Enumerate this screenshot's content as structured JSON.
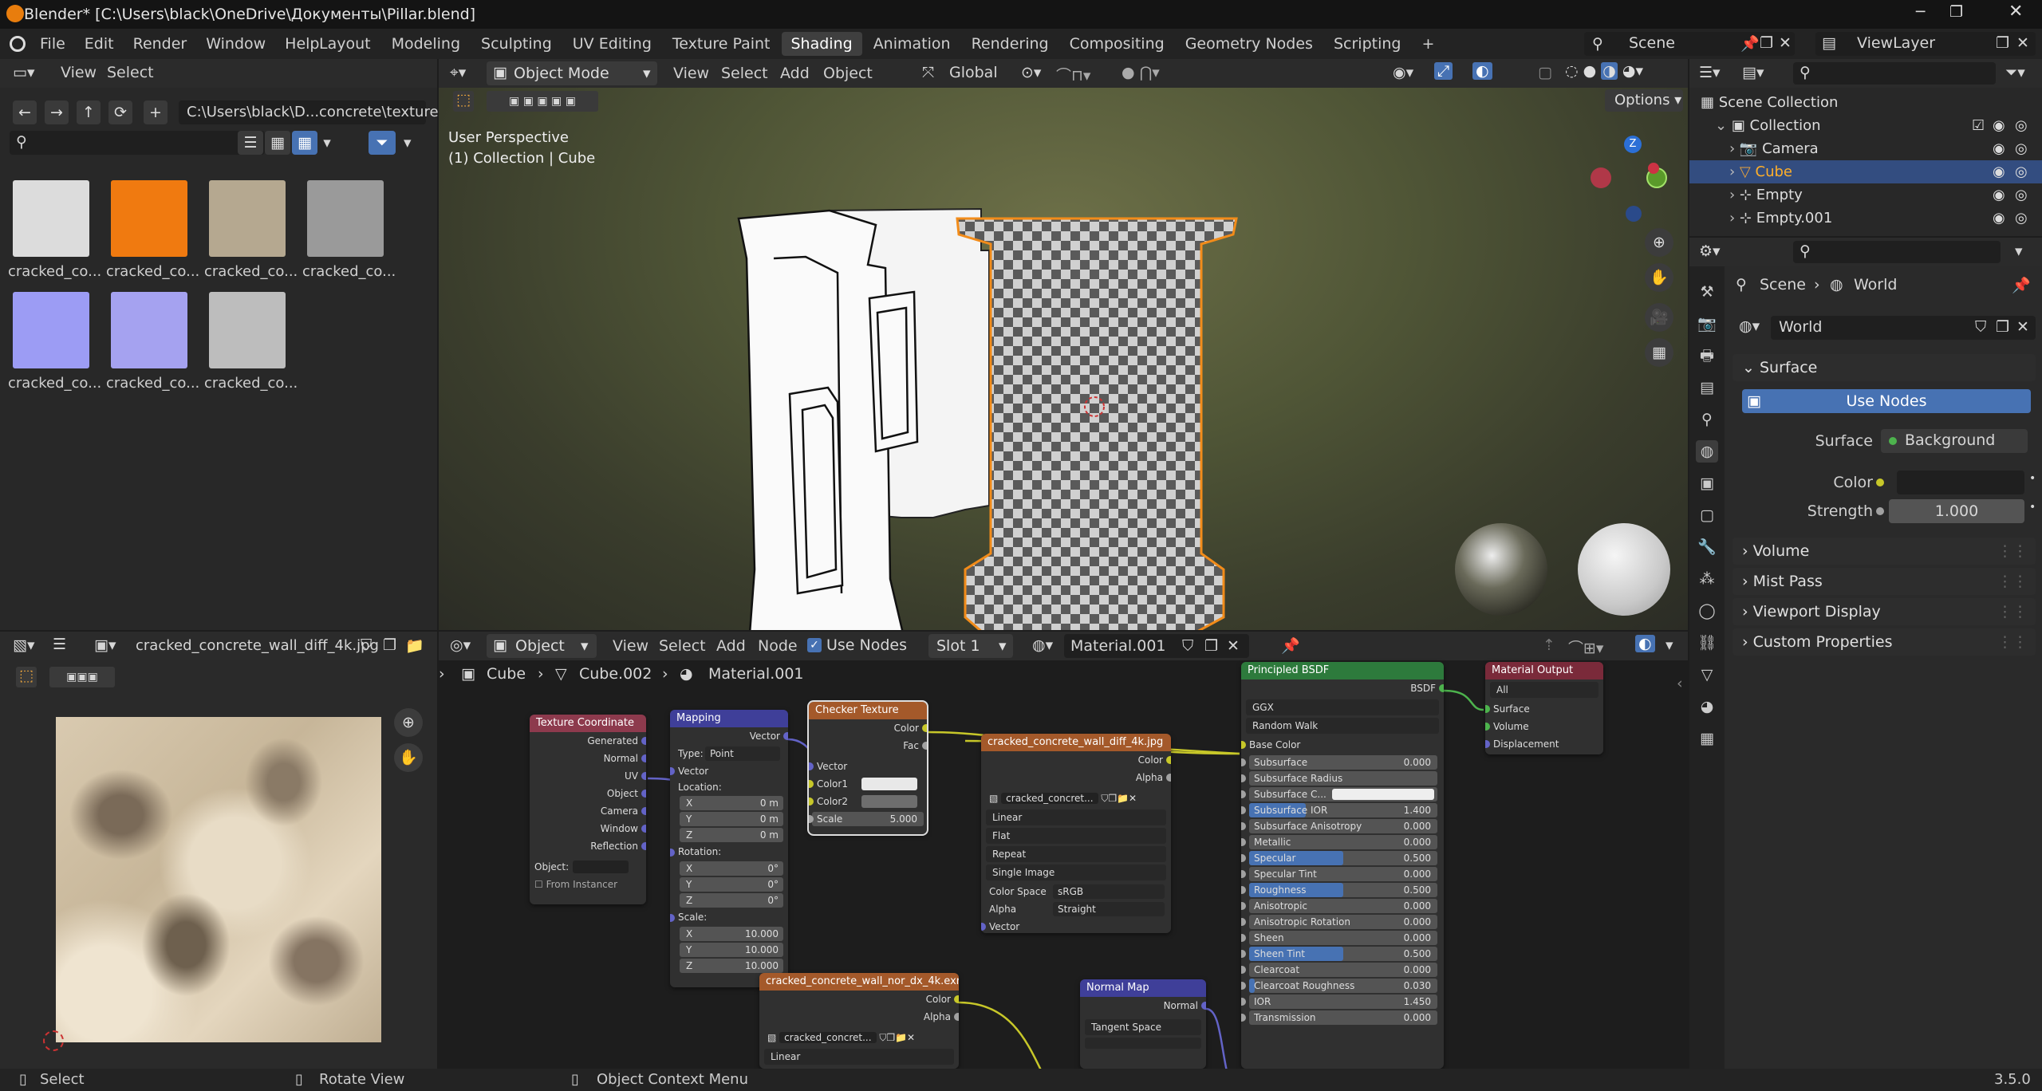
{
  "app": {
    "title": "Blender* [C:\\Users\\black\\OneDrive\\Документы\\Pillar.blend]",
    "version": "3.5.0"
  },
  "menu": [
    "File",
    "Edit",
    "Render",
    "Window",
    "Help"
  ],
  "workspaces": [
    "Layout",
    "Modeling",
    "Sculpting",
    "UV Editing",
    "Texture Paint",
    "Shading",
    "Animation",
    "Rendering",
    "Compositing",
    "Geometry Nodes",
    "Scripting"
  ],
  "active_workspace": "Shading",
  "scene": {
    "name": "Scene",
    "view_layer": "ViewLayer"
  },
  "file_browser": {
    "menu": [
      "View",
      "Select"
    ],
    "path": "C:\\Users\\black\\D...concrete\\textures\\",
    "search_placeholder": "",
    "items": [
      {
        "label": "cracked_co...",
        "color": "#dcdcdc"
      },
      {
        "label": "cracked_co...",
        "color": "#f07a10"
      },
      {
        "label": "cracked_co...",
        "color": "#b5a890"
      },
      {
        "label": "cracked_co...",
        "color": "#9a9a9a"
      },
      {
        "label": "cracked_co...",
        "color": "#9c9cf4"
      },
      {
        "label": "cracked_co...",
        "color": "#a5a2f0"
      },
      {
        "label": "cracked_co...",
        "color": "#bdbdbd"
      }
    ]
  },
  "viewport": {
    "mode": "Object Mode",
    "menu": [
      "View",
      "Select",
      "Add",
      "Object"
    ],
    "orientation": "Global",
    "options_label": "Options",
    "overlay_title": "User Perspective",
    "overlay_sub": "(1) Collection | Cube"
  },
  "image_editor": {
    "image_name": "cracked_concrete_wall_diff_4k.jpg"
  },
  "node_editor": {
    "editor_type": "Object",
    "menu": [
      "View",
      "Select",
      "Add",
      "Node"
    ],
    "use_nodes_label": "Use Nodes",
    "slot": "Slot 1",
    "material": "Material.001",
    "breadcrumb": [
      "Cube",
      "Cube.002",
      "Material.001"
    ],
    "nodes": {
      "texcoord": {
        "title": "Texture Coordinate",
        "outputs": [
          "Generated",
          "Normal",
          "UV",
          "Object",
          "Camera",
          "Window",
          "Reflection"
        ],
        "object_label": "Object:",
        "from_instancer": "From Instancer"
      },
      "mapping": {
        "title": "Mapping",
        "output": "Vector",
        "type_label": "Type:",
        "type_value": "Point",
        "vector": "Vector",
        "location": "Location:",
        "loc": [
          [
            "X",
            "0 m"
          ],
          [
            "Y",
            "0 m"
          ],
          [
            "Z",
            "0 m"
          ]
        ],
        "rotation": "Rotation:",
        "rot": [
          [
            "X",
            "0°"
          ],
          [
            "Y",
            "0°"
          ],
          [
            "Z",
            "0°"
          ]
        ],
        "scale": "Scale:",
        "scl": [
          [
            "X",
            "10.000"
          ],
          [
            "Y",
            "10.000"
          ],
          [
            "Z",
            "10.000"
          ]
        ]
      },
      "checker": {
        "title": "Checker Texture",
        "outputs": [
          "Color",
          "Fac"
        ],
        "inputs": [
          "Vector",
          "Color1",
          "Color2"
        ],
        "scale_label": "Scale",
        "scale_value": "5.000"
      },
      "diff": {
        "title": "cracked_concrete_wall_diff_4k.jpg",
        "outputs": [
          "Color",
          "Alpha"
        ],
        "image": "cracked_concret...",
        "interp": "Linear",
        "proj": "Flat",
        "ext": "Repeat",
        "source": "Single Image",
        "cs_label": "Color Space",
        "cs_value": "sRGB",
        "alpha_label": "Alpha",
        "alpha_value": "Straight",
        "input": "Vector"
      },
      "nor": {
        "title": "cracked_concrete_wall_nor_dx_4k.exr",
        "outputs": [
          "Color",
          "Alpha"
        ],
        "image": "cracked_concret...",
        "interp": "Linear"
      },
      "normalmap": {
        "title": "Normal Map",
        "output": "Normal",
        "space": "Tangent Space"
      },
      "bsdf": {
        "title": "Principled BSDF",
        "output": "BSDF",
        "dist": "GGX",
        "sss": "Random Walk",
        "base": "Base Color",
        "rows": [
          [
            "Subsurface",
            "0.000",
            0
          ],
          [
            "Subsurface Radius",
            "",
            0
          ],
          [
            "Subsurface C...",
            "",
            0
          ],
          [
            "Subsurface IOR",
            "1.400",
            0.3
          ],
          [
            "Subsurface Anisotropy",
            "0.000",
            0
          ],
          [
            "Metallic",
            "0.000",
            0
          ],
          [
            "Specular",
            "0.500",
            0.5
          ],
          [
            "Specular Tint",
            "0.000",
            0
          ],
          [
            "Roughness",
            "0.500",
            0.5
          ],
          [
            "Anisotropic",
            "0.000",
            0
          ],
          [
            "Anisotropic Rotation",
            "0.000",
            0
          ],
          [
            "Sheen",
            "0.000",
            0
          ],
          [
            "Sheen Tint",
            "0.500",
            0.5
          ],
          [
            "Clearcoat",
            "0.000",
            0
          ],
          [
            "Clearcoat Roughness",
            "0.030",
            0.03
          ],
          [
            "IOR",
            "1.450",
            0
          ],
          [
            "Transmission",
            "0.000",
            0
          ]
        ]
      },
      "output": {
        "title": "Material Output",
        "target": "All",
        "inputs": [
          "Surface",
          "Volume",
          "Displacement"
        ]
      }
    }
  },
  "outliner": {
    "rows": [
      {
        "label": "Scene Collection",
        "indent": 0
      },
      {
        "label": "Collection",
        "indent": 1
      },
      {
        "label": "Camera",
        "indent": 2
      },
      {
        "label": "Cube",
        "indent": 2,
        "selected": true
      },
      {
        "label": "Empty",
        "indent": 2
      },
      {
        "label": "Empty.001",
        "indent": 2
      }
    ]
  },
  "properties": {
    "breadcrumb": [
      "Scene",
      "World"
    ],
    "world_name": "World",
    "surface_panel": "Surface",
    "use_nodes": "Use Nodes",
    "surface_label": "Surface",
    "surface_value": "Background",
    "color_label": "Color",
    "strength_label": "Strength",
    "strength_value": "1.000",
    "panels": [
      "Volume",
      "Mist Pass",
      "Viewport Display",
      "Custom Properties"
    ]
  },
  "status": {
    "select": "Select",
    "rotate": "Rotate View",
    "context": "Object Context Menu"
  }
}
